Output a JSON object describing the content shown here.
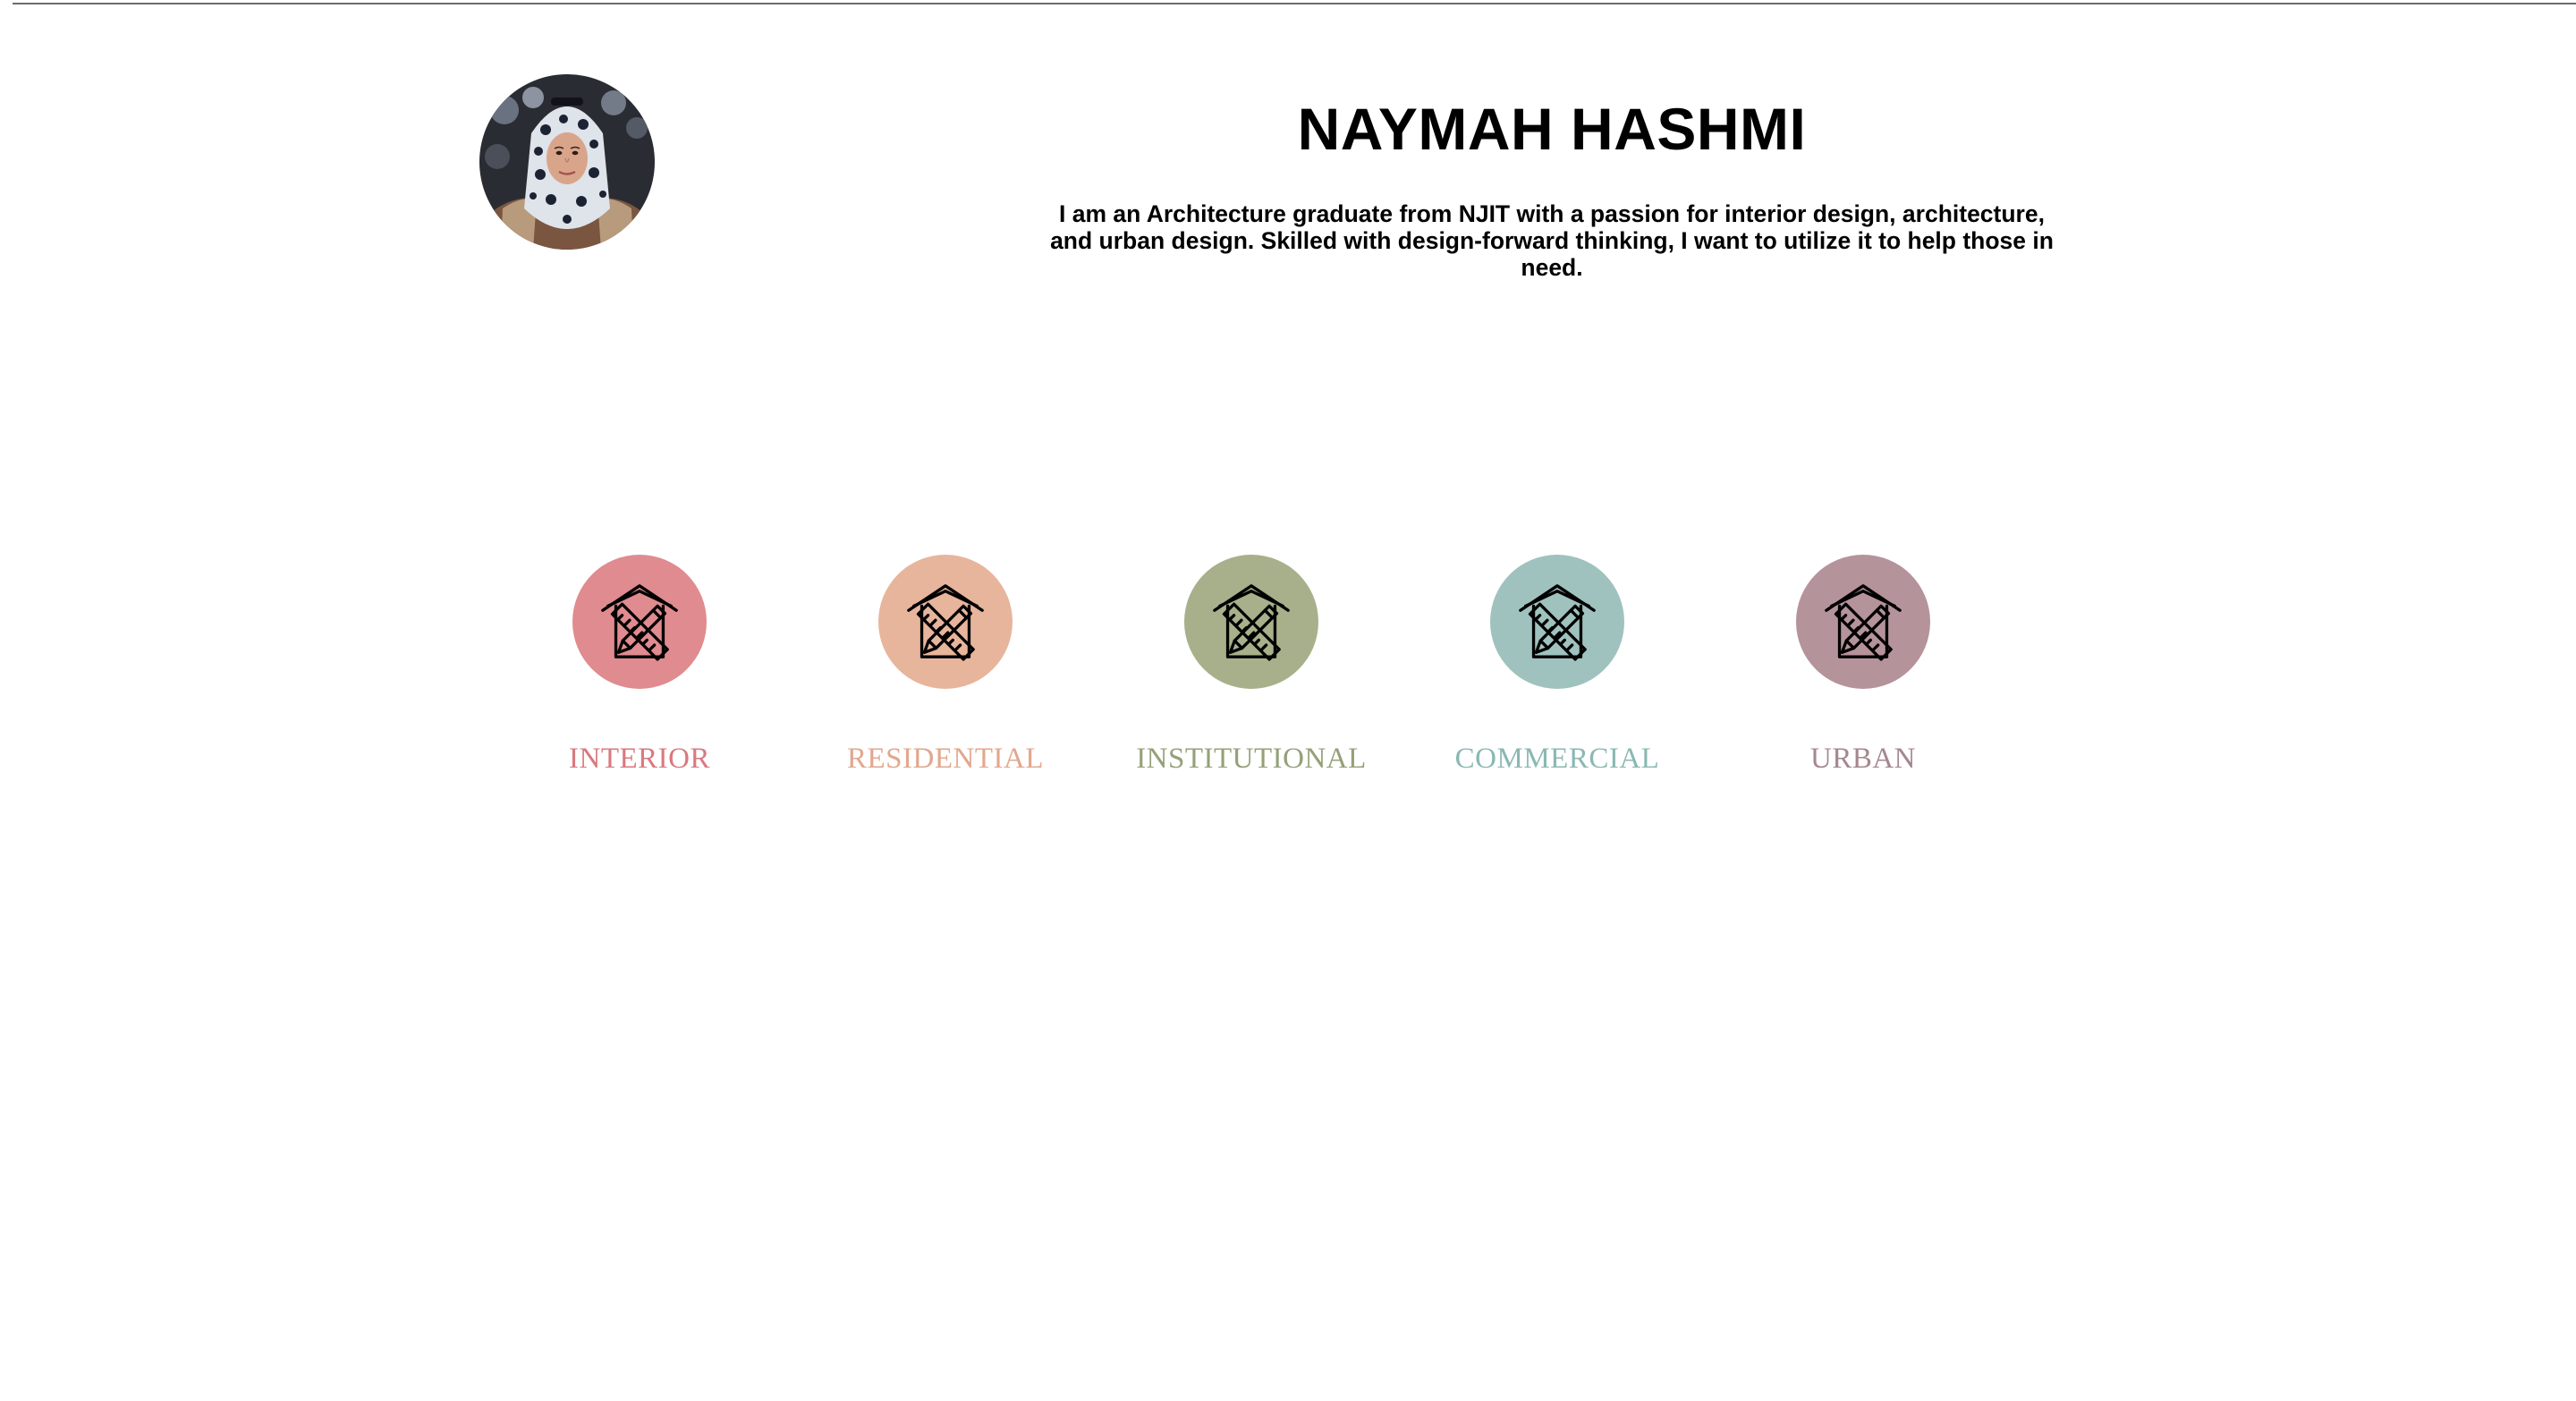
{
  "profile": {
    "name": "NAYMAH HASHMI",
    "bio": "I am an Architecture graduate from NJIT with a passion for interior design, architecture, and urban design. Skilled with design-forward thinking, I want to utilize it to help those in need.",
    "avatar_icon": "profile-photo"
  },
  "categories": [
    {
      "label": "INTERIOR",
      "circle_color": "#e08b8f",
      "text_color": "#d9797f",
      "icon": "house-pencil-ruler-icon"
    },
    {
      "label": "RESIDENTIAL",
      "circle_color": "#e7b59c",
      "text_color": "#e2a78d",
      "icon": "house-pencil-ruler-icon"
    },
    {
      "label": "INSTITUTIONAL",
      "circle_color": "#a7b08a",
      "text_color": "#95a078",
      "icon": "house-pencil-ruler-icon"
    },
    {
      "label": "COMMERCIAL",
      "circle_color": "#9fc2be",
      "text_color": "#8ab8b3",
      "icon": "house-pencil-ruler-icon"
    },
    {
      "label": "URBAN",
      "circle_color": "#b5939b",
      "text_color": "#a58790",
      "icon": "house-pencil-ruler-icon"
    }
  ]
}
